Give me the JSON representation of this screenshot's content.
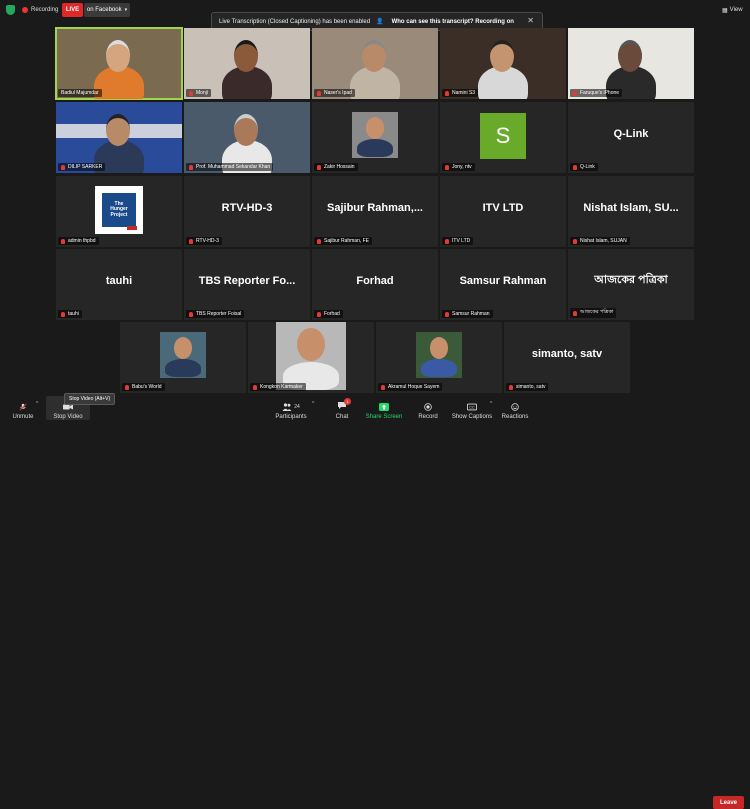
{
  "topbar": {
    "recording_label": "Recording",
    "live_label": "LIVE",
    "facebook_label": "on Facebook",
    "view_label": "View"
  },
  "banner": {
    "message": "Live Transcription (Closed Captioning) has been enabled",
    "who_link": "Who can see this transcript? Recording on"
  },
  "tiles": [
    {
      "name": "Badiul Majumdar",
      "type": "video",
      "active": true
    },
    {
      "name": "Monji",
      "type": "video"
    },
    {
      "name": "Naser's Ipad",
      "type": "video"
    },
    {
      "name": "Namini S3",
      "type": "video"
    },
    {
      "name": "Faruque's iPhone",
      "type": "video"
    },
    {
      "name": "DILIP SARKER",
      "type": "video"
    },
    {
      "name": "Prof. Muhammad Sekandar Khan",
      "type": "video"
    },
    {
      "name": "Zakir Hossain",
      "type": "photo"
    },
    {
      "name": "Jony, ntv",
      "type": "avatar",
      "initial": "S"
    },
    {
      "name": "Q-Link",
      "type": "text",
      "big": "Q-Link"
    },
    {
      "name": "admin thpbd",
      "type": "logo",
      "logo_lines": [
        "The",
        "Hunger",
        "Project"
      ]
    },
    {
      "name": "RTV-HD-3",
      "type": "text",
      "big": "RTV-HD-3"
    },
    {
      "name": "Sajibur Rahman, FE",
      "type": "text",
      "big": "Sajibur  Rahman,..."
    },
    {
      "name": "ITV LTD",
      "type": "text",
      "big": "ITV LTD"
    },
    {
      "name": "Nishat Islam, SUJAN",
      "type": "text",
      "big": "Nishat Islam, SU..."
    },
    {
      "name": "tauhi",
      "type": "text",
      "big": "tauhi"
    },
    {
      "name": "TBS Reporter Foisal",
      "type": "text",
      "big": "TBS Reporter Fo..."
    },
    {
      "name": "Forhad",
      "type": "text",
      "big": "Forhad"
    },
    {
      "name": "Samsur Rahman",
      "type": "text",
      "big": "Samsur Rahman"
    },
    {
      "name": "আজকের পত্রিকা",
      "type": "text",
      "big": "আজকের পত্রিকা"
    },
    {
      "name": "Babu's World",
      "type": "photo"
    },
    {
      "name": "Kongkon Karmaker",
      "type": "photo"
    },
    {
      "name": "Akramul Hoque Sayem",
      "type": "photo"
    },
    {
      "name": "simanto, satv",
      "type": "text",
      "big": "simanto, satv"
    }
  ],
  "toolbar": {
    "unmute": "Unmute",
    "stop_video": "Stop Video",
    "stop_video_tooltip": "Stop Video (Alt+V)",
    "participants": "Participants",
    "participants_count": "24",
    "chat": "Chat",
    "chat_badge": "1",
    "share_screen": "Share Screen",
    "record": "Record",
    "show_captions": "Show Captions",
    "reactions": "Reactions",
    "leave": "Leave"
  },
  "colors": {
    "background": "#1a1a1a",
    "tile": "#262626",
    "active_outline": "#9fd64a",
    "live_red": "#e02828",
    "share_green": "#23d96a",
    "avatar_green": "#6aaa2a",
    "leave_red": "#c62828"
  }
}
